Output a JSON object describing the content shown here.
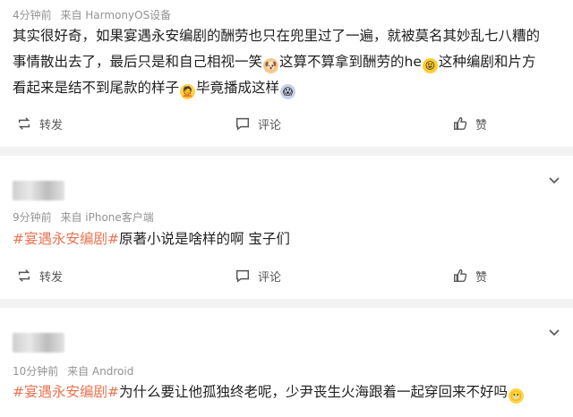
{
  "posts": [
    {
      "time": "4分钟前",
      "source": "来自 HarmonyOS设备",
      "text": {
        "line1": "其实很好奇，如果宴遇永安编剧的酬劳也只在兜里过了一遍，就被莫名其妙乱七八糟的",
        "line2a": "事情散出去了，最后只是和自己相视一笑",
        "line2b": "这算不算拿到酬劳的he",
        "line2c": "这种编剧和片方",
        "line3a": "看起来是结不到尾款的样子",
        "line3b": "毕竟播成这样"
      },
      "actions": {
        "repost": "转发",
        "comment": "评论",
        "like": "赞"
      }
    },
    {
      "time": "9分钟前",
      "source": "来自 iPhone客户端",
      "hashtag": "#宴遇永安编剧#",
      "text": "原著小说是啥样的啊 宝子们",
      "actions": {
        "repost": "转发",
        "comment": "评论",
        "like": "赞"
      }
    },
    {
      "time": "10分钟前",
      "source": "来自 Android",
      "hashtag": "#宴遇永安编剧#",
      "text": "为什么要让他孤独终老呢，少尹丧生火海跟着一起穿回来不好吗"
    }
  ],
  "colors": {
    "hashtag": "#eb7350",
    "divider": "#f2f2f2",
    "meta": "#939393"
  },
  "icons": [
    "repost-icon",
    "comment-icon",
    "like-icon",
    "chevron-down-icon"
  ]
}
